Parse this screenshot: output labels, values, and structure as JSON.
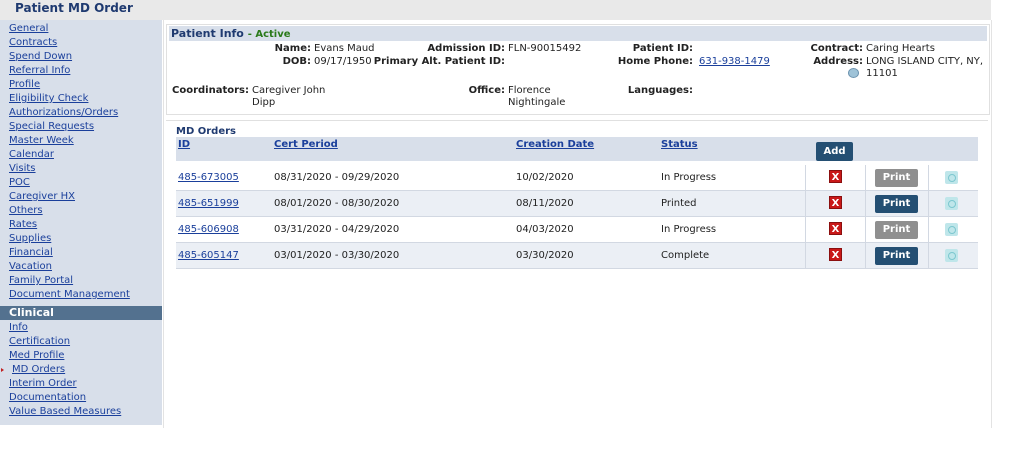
{
  "page": {
    "title": "Patient MD Order"
  },
  "sidebar": {
    "items": [
      "General",
      "Contracts",
      "Spend Down",
      "Referral Info",
      "Profile",
      "Eligibility Check",
      "Authorizations/Orders",
      "Special Requests",
      "Master Week",
      "Calendar",
      "Visits",
      "POC",
      "Caregiver HX",
      "Others",
      "Rates",
      "Supplies",
      "Financial",
      "Vacation",
      "Family Portal",
      "Document Management"
    ],
    "clinical_header": "Clinical",
    "clinical_items": [
      "Info",
      "Certification",
      "Med Profile",
      "MD Orders",
      "Interim Order",
      "Documentation",
      "Value Based Measures"
    ],
    "active_item": "MD Orders"
  },
  "patient": {
    "header": "Patient Info",
    "status": "- Active",
    "name_label": "Name:",
    "name": "Evans Maud",
    "dob_label": "DOB:",
    "dob": "09/17/1950",
    "admission_label": "Admission ID:",
    "admission_id": "FLN-90015492",
    "alt_label": "Primary Alt. Patient ID:",
    "alt_id": "",
    "patient_id_label": "Patient ID:",
    "patient_id": "",
    "phone_label": "Home Phone:",
    "phone": "631-938-1479",
    "contract_label": "Contract:",
    "contract": "Caring Hearts",
    "address_label": "Address:",
    "address_line1": "LONG ISLAND CITY, NY,",
    "address_line2": "11101",
    "coordinators_label": "Coordinators:",
    "coordinators_line1": "Caregiver John",
    "coordinators_line2": "Dipp",
    "office_label": "Office:",
    "office_line1": "Florence",
    "office_line2": "Nightingale",
    "languages_label": "Languages:",
    "languages": ""
  },
  "orders": {
    "title": "MD Orders",
    "columns": {
      "id": "ID",
      "cert": "Cert Period",
      "created": "Creation Date",
      "status": "Status"
    },
    "add_label": "Add",
    "print_label": "Print",
    "delete_label": "X",
    "rows": [
      {
        "id": "485-673005",
        "cert": "08/31/2020 - 09/29/2020",
        "created": "10/02/2020",
        "status": "In Progress",
        "print_state": "disabled"
      },
      {
        "id": "485-651999",
        "cert": "08/01/2020 - 08/30/2020",
        "created": "08/11/2020",
        "status": "Printed",
        "print_state": "enabled"
      },
      {
        "id": "485-606908",
        "cert": "03/31/2020 - 04/29/2020",
        "created": "04/03/2020",
        "status": "In Progress",
        "print_state": "disabled"
      },
      {
        "id": "485-605147",
        "cert": "03/01/2020 - 03/30/2020",
        "created": "03/30/2020",
        "status": "Complete",
        "print_state": "enabled"
      }
    ]
  }
}
